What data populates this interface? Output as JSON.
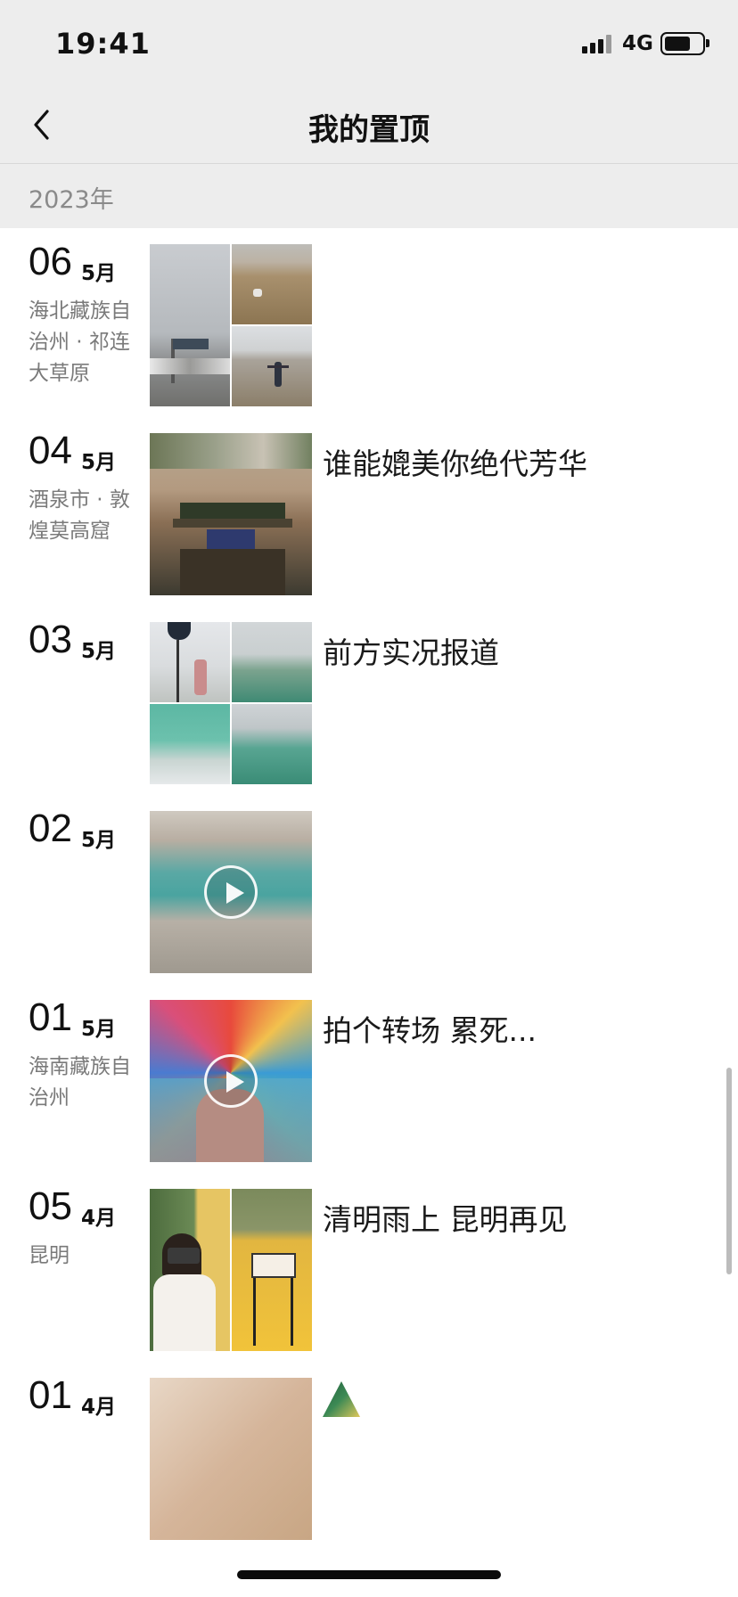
{
  "status_bar": {
    "time": "19:41",
    "network": "4G"
  },
  "nav": {
    "title": "我的置顶",
    "back_icon": "chevron-left-icon"
  },
  "year_label": "2023年",
  "posts": [
    {
      "day": "06",
      "month": "5月",
      "location": "海北藏族自治州 · 祁连大草原",
      "caption": "",
      "media": "photo-grid-3"
    },
    {
      "day": "04",
      "month": "5月",
      "location": "酒泉市 · 敦煌莫高窟",
      "caption": "谁能媲美你绝代芳华",
      "media": "photo-single"
    },
    {
      "day": "03",
      "month": "5月",
      "location": "",
      "caption": "前方实况报道",
      "media": "photo-grid-4"
    },
    {
      "day": "02",
      "month": "5月",
      "location": "",
      "caption": "",
      "media": "video"
    },
    {
      "day": "01",
      "month": "5月",
      "location": "海南藏族自治州",
      "caption": "拍个转场 累死...",
      "media": "video"
    },
    {
      "day": "05",
      "month": "4月",
      "location": "昆明",
      "caption": "清明雨上 昆明再见",
      "media": "photo-grid-2"
    },
    {
      "day": "01",
      "month": "4月",
      "location": "",
      "caption": "",
      "media": "photo-single"
    }
  ],
  "icons": {
    "play": "play-icon",
    "signal": "signal-icon",
    "battery": "battery-icon"
  }
}
